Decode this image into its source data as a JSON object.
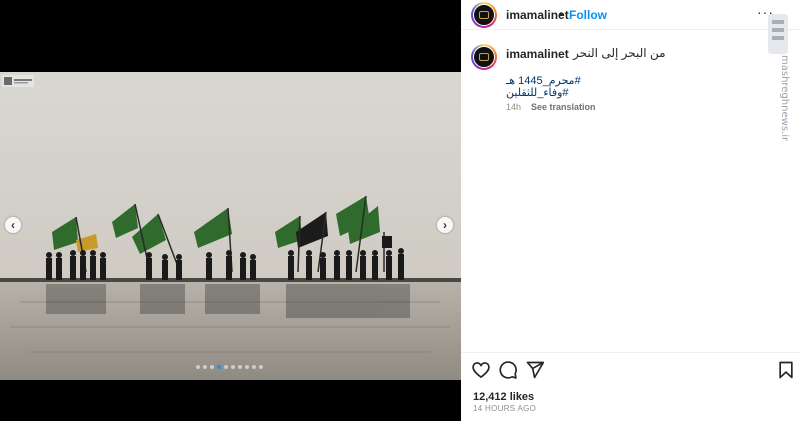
{
  "account": {
    "username": "imamalinet",
    "follow_label": "Follow",
    "separator": "•",
    "more_label": "···"
  },
  "post": {
    "caption": "من البحر إلى النحر",
    "hashtags": [
      "#محرم_1445 هـ",
      "#وفاء_للثقلين"
    ],
    "time": "14h",
    "translate_label": "See translation",
    "likes": "12,412 likes",
    "time_ago": "14 HOURS AGO"
  },
  "carousel": {
    "prev_label": "‹",
    "next_label": "›",
    "slide_count": 10,
    "active_index": 3
  },
  "watermark": {
    "side_text": "mashreghnews.ir"
  },
  "icons": {
    "like": "heart-icon",
    "comment": "comment-icon",
    "share": "share-icon",
    "save": "bookmark-icon"
  },
  "colors": {
    "follow_blue": "#0095f6",
    "hashtag_blue": "#00376b",
    "muted": "#8e8e8e"
  }
}
